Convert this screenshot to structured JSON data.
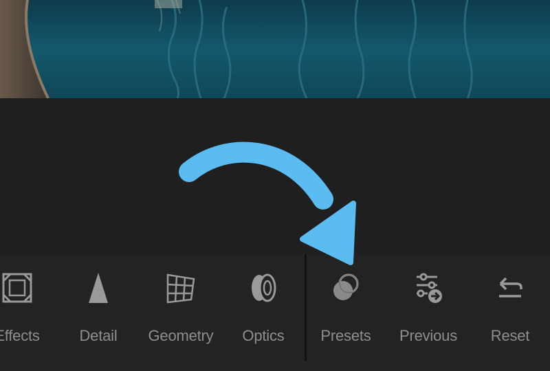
{
  "toolbar": {
    "tools": [
      {
        "label": "Effects",
        "icon": "effects-icon"
      },
      {
        "label": "Detail",
        "icon": "detail-icon"
      },
      {
        "label": "Geometry",
        "icon": "geometry-icon"
      },
      {
        "label": "Optics",
        "icon": "optics-icon"
      },
      {
        "label": "Presets",
        "icon": "presets-icon"
      },
      {
        "label": "Previous",
        "icon": "previous-icon"
      },
      {
        "label": "Reset",
        "icon": "reset-icon"
      }
    ]
  },
  "colors": {
    "annotation_arrow": "#5bbcf2",
    "toolbar_bg": "#232323",
    "label_text": "#8f8f8f",
    "icon_color": "#9a9a9a"
  }
}
